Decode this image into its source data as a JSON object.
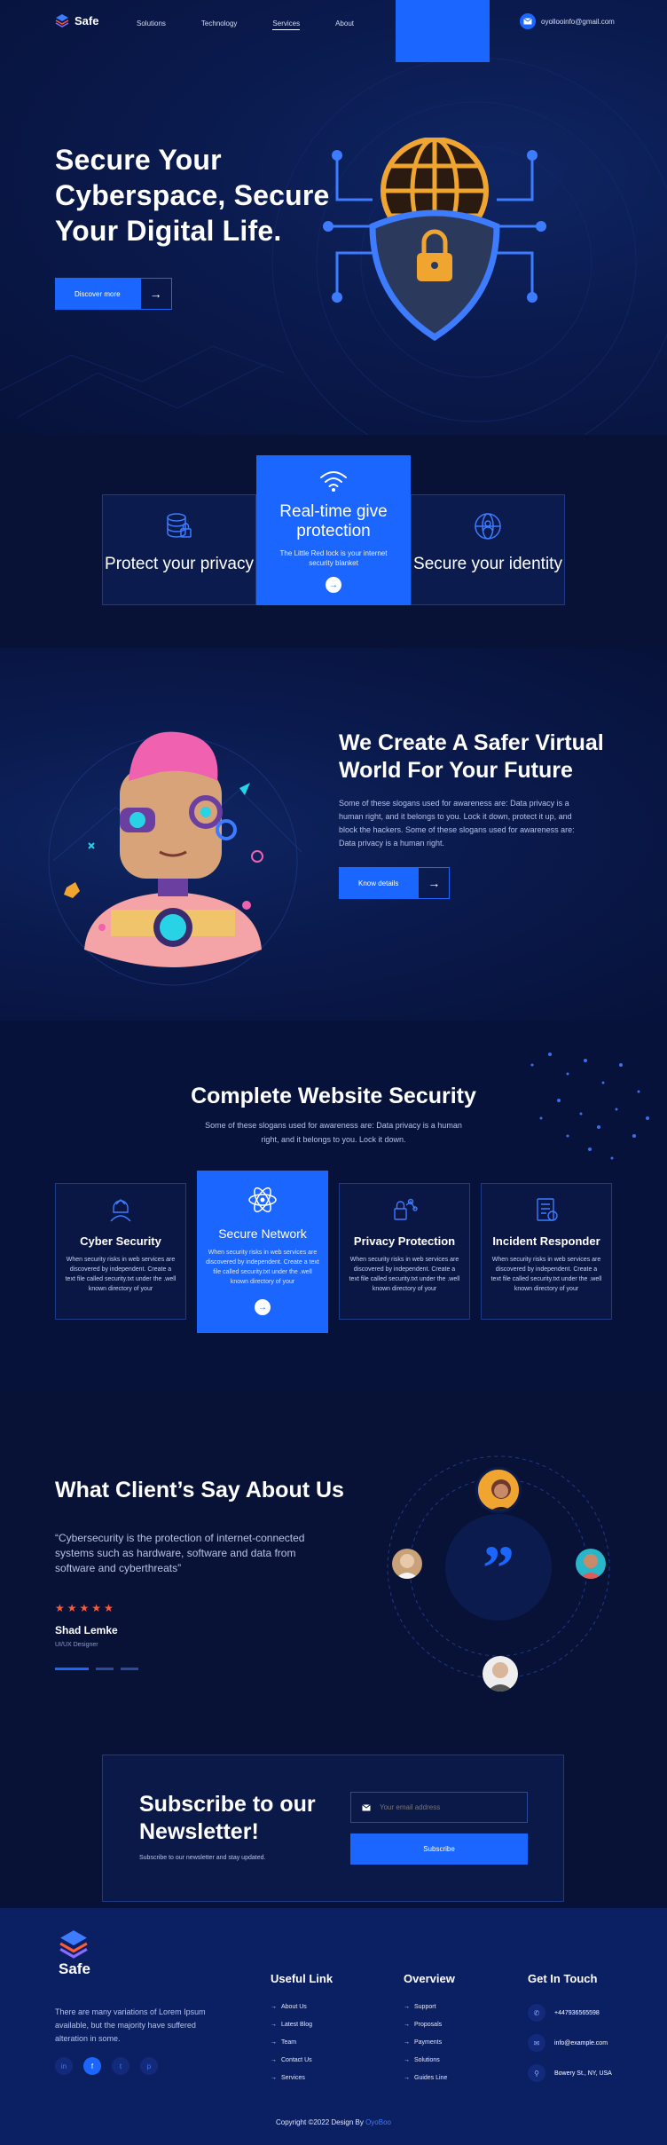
{
  "brand": {
    "name": "Safe"
  },
  "nav": {
    "items": [
      "Solutions",
      "Technology",
      "Services",
      "About"
    ],
    "active": "Services"
  },
  "header": {
    "email": "oyollooinfo@gmail.com"
  },
  "hero": {
    "title": "Secure Your Cyberspace, Secure Your Digital Life.",
    "cta": "Discover more"
  },
  "features": {
    "left": {
      "title": "Protect your privacy",
      "icon": "database-lock-icon"
    },
    "middle": {
      "title": "Real-time give protection",
      "subtitle": "The Little Red lock is your internet security blanket",
      "icon": "wifi-icon"
    },
    "right": {
      "title": "Secure your identity",
      "icon": "globe-identity-icon"
    }
  },
  "safer": {
    "title": "We Create A Safer Virtual World For Your Future",
    "text": "Some of these slogans used for awareness are: Data privacy is a human right, and it belongs to you. Lock it down, protect it up, and block the hackers. Some of these slogans used for awareness are: Data privacy is a human right.",
    "cta": "Know details"
  },
  "services": {
    "title": "Complete Website Security",
    "subtitle": "Some of these slogans used for awareness are: Data privacy is a human right, and it belongs to you. Lock it down.",
    "cards": [
      {
        "title": "Cyber Security",
        "text": "When security risks in web services are discovered by independent. Create a text file called security.txt under the .well known directory of your",
        "icon": "hacker-icon"
      },
      {
        "title": "Secure Network",
        "text": "When security risks in web services are discovered by independent. Create a text file called security.txt under the .well known directory of your",
        "icon": "atom-icon"
      },
      {
        "title": "Privacy Protection",
        "text": "When security risks in web services are discovered by independent. Create a text file called security.txt under the .well known directory of your",
        "icon": "lock-network-icon"
      },
      {
        "title": "Incident Responder",
        "text": "When security risks in web services are discovered by independent. Create a text file called security.txt under the .well known directory of your",
        "icon": "report-icon"
      }
    ]
  },
  "testimonials": {
    "title": "What Client’s Say About Us",
    "quote": "“Cybersecurity is the protection of internet-connected systems such as hardware, software and data from software and cyberthreats”",
    "rating": 5,
    "name": "Shad Lemke",
    "role": "UI/UX Designer"
  },
  "newsletter": {
    "title": "Subscribe to our Newsletter!",
    "subtitle": "Subscribe to our newsletter and stay updated.",
    "placeholder": "Your email address",
    "button": "Subscribe"
  },
  "footer": {
    "brand": "Safe",
    "about": "There are many variations of Lorem Ipsum available, but the majority have suffered alteration in some.",
    "useful": {
      "title": "Useful Link",
      "links": [
        "About Us",
        "Latest Blog",
        "Team",
        "Contact Us",
        "Services"
      ]
    },
    "overview": {
      "title": "Overview",
      "links": [
        "Support",
        "Proposals",
        "Payments",
        "Solutions",
        "Guides Line"
      ]
    },
    "contact": {
      "title": "Get In Touch",
      "phone": "+447936565598",
      "email": "info@example.com",
      "address": "Bowery St., NY, USA"
    },
    "social": [
      "in",
      "f",
      "t",
      "p"
    ],
    "copyright": "Copyright ©2022 Design By",
    "designer": "OyoBoo"
  },
  "colors": {
    "accent": "#1a66ff",
    "background": "#081236",
    "star": "#ff5a36"
  }
}
